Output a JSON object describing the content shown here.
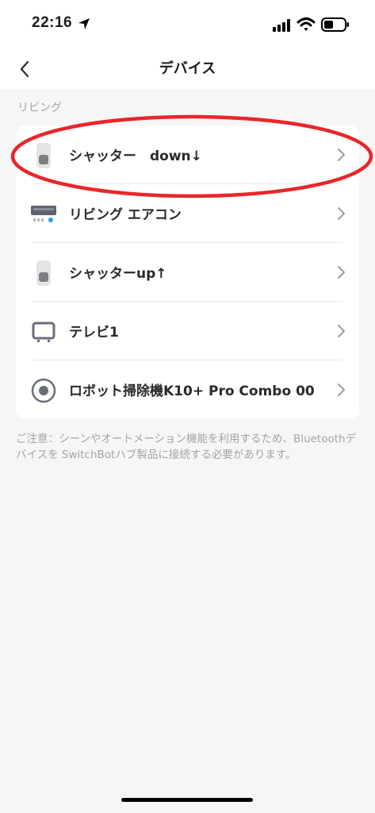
{
  "status_bar": {
    "time": "22:16"
  },
  "nav": {
    "title": "デバイス"
  },
  "section": {
    "label": "リビング"
  },
  "devices": [
    {
      "label": "シャッター　down↓",
      "icon": "shutter-icon"
    },
    {
      "label": "リビング エアコン",
      "icon": "air-conditioner-icon"
    },
    {
      "label": "シャッターup↑",
      "icon": "shutter-icon"
    },
    {
      "label": "テレビ1",
      "icon": "tv-icon"
    },
    {
      "label": "ロボット掃除機K10+ Pro Combo 00",
      "icon": "robot-vacuum-icon"
    }
  ],
  "note": "ご注意：シーンやオートメーション機能を利用するため、Bluetoothデバイスを SwitchBotハブ製品に接続する必要があります。",
  "colors": {
    "background": "#f6f6f6",
    "card": "#ffffff",
    "highlight": "#e8262b",
    "secondary_text": "#a4a4a8"
  }
}
